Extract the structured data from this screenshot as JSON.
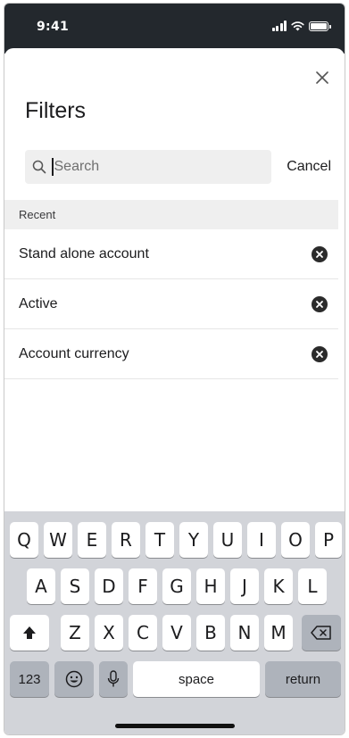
{
  "status_bar": {
    "time": "9:41"
  },
  "sheet": {
    "title": "Filters",
    "close_icon": "close-icon",
    "search": {
      "placeholder": "Search",
      "value": ""
    },
    "cancel_label": "Cancel",
    "recent_header": "Recent",
    "recent_items": [
      {
        "label": "Stand alone account"
      },
      {
        "label": "Active"
      },
      {
        "label": "Account currency"
      }
    ]
  },
  "keyboard": {
    "row1": [
      "Q",
      "W",
      "E",
      "R",
      "T",
      "Y",
      "U",
      "I",
      "O",
      "P"
    ],
    "row2": [
      "A",
      "S",
      "D",
      "F",
      "G",
      "H",
      "J",
      "K",
      "L"
    ],
    "row3": [
      "Z",
      "X",
      "C",
      "V",
      "B",
      "N",
      "M"
    ],
    "numbers_label": "123",
    "space_label": "space",
    "return_label": "return"
  },
  "colors": {
    "status_bar_bg": "#23282d",
    "keyboard_bg": "#d2d4d9",
    "search_bg": "#efefef"
  }
}
